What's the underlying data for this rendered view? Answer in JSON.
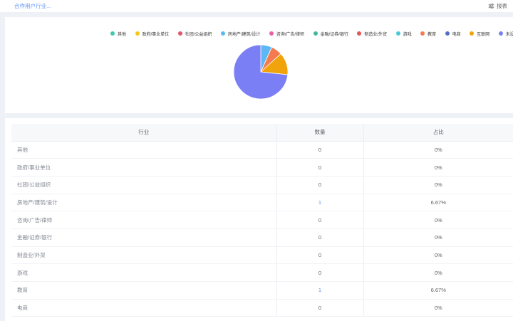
{
  "header": {
    "title": "合作用户行业...",
    "report_label": "报表"
  },
  "legend": [
    {
      "label": "其他",
      "color": "#3fc8b0"
    },
    {
      "label": "政府/事业单位",
      "color": "#f5c518"
    },
    {
      "label": "社团/公益组织",
      "color": "#e9546b"
    },
    {
      "label": "房地产/建筑/设计",
      "color": "#5cb8f5"
    },
    {
      "label": "咨询/广告/律师",
      "color": "#ea5fa9"
    },
    {
      "label": "金融/证券/银行",
      "color": "#3fb8a0"
    },
    {
      "label": "制造业/外贸",
      "color": "#e45757"
    },
    {
      "label": "游戏",
      "color": "#48c9d6"
    },
    {
      "label": "教育",
      "color": "#f47b4f"
    },
    {
      "label": "电商",
      "color": "#5470c6"
    },
    {
      "label": "互联网",
      "color": "#f0a30a"
    },
    {
      "label": "未设置",
      "color": "#7b7ff5"
    }
  ],
  "chart_data": {
    "type": "pie",
    "slices": [
      {
        "label": "房地产/建筑/设计",
        "value": 1,
        "color": "#5cb8f5"
      },
      {
        "label": "教育",
        "value": 1,
        "color": "#f47b4f"
      },
      {
        "label": "互联网",
        "value": 2,
        "color": "#f0a30a"
      },
      {
        "label": "未设置",
        "value": 11,
        "color": "#7b7ff5"
      }
    ]
  },
  "table": {
    "headers": [
      "行业",
      "数量",
      "占比"
    ],
    "rows": [
      {
        "name": "其他",
        "count": "0",
        "pct": "0%"
      },
      {
        "name": "政府/事业单位",
        "count": "0",
        "pct": "0%"
      },
      {
        "name": "社团/公益组织",
        "count": "0",
        "pct": "0%"
      },
      {
        "name": "房地产/建筑/设计",
        "count": "1",
        "pct": "6.67%"
      },
      {
        "name": "咨询/广告/律师",
        "count": "0",
        "pct": "0%"
      },
      {
        "name": "金融/证券/银行",
        "count": "0",
        "pct": "0%"
      },
      {
        "name": "制造业/外贸",
        "count": "0",
        "pct": "0%"
      },
      {
        "name": "游戏",
        "count": "0",
        "pct": "0%"
      },
      {
        "name": "教育",
        "count": "1",
        "pct": "6.67%"
      },
      {
        "name": "电商",
        "count": "0",
        "pct": "0%"
      }
    ]
  }
}
